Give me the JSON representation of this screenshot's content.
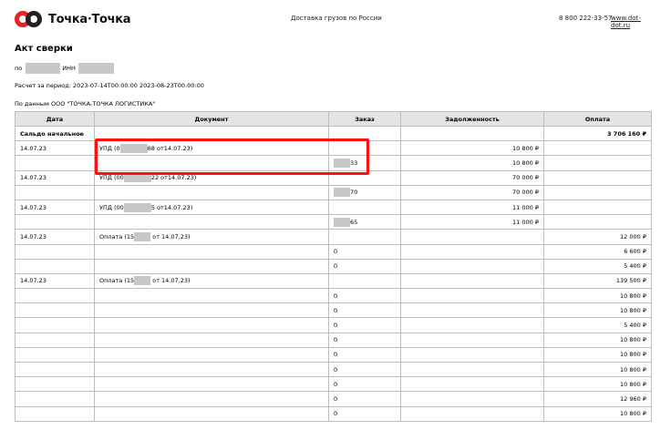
{
  "header": {
    "logo_text": "Точка·Точка",
    "tagline": "Доставка грузов по России",
    "phone": "8 800 222-33-57",
    "site": "www.dot-dot.ru"
  },
  "doc": {
    "title": "Акт сверки",
    "party_prefix": "по",
    "inn_label": "ИНН",
    "period": "Расчет за период: 2023-07-14T00:00:00 2023-08-23T00:00:00",
    "source": "По данным ООО \"ТОЧКА-ТОЧКА ЛОГИСТИКА\""
  },
  "table": {
    "columns": [
      "Дата",
      "Документ",
      "Заказ",
      "Задолженность",
      "Оплата"
    ],
    "rows": [
      [
        "Сальдо начальное",
        "",
        "",
        "",
        "3 706 160 ₽"
      ],
      [
        "14.07.23",
        "УПД (0█████68 от14.07.23)",
        "",
        "10 800 ₽",
        ""
      ],
      [
        "",
        "",
        "███33",
        "10 800 ₽",
        ""
      ],
      [
        "14.07.23",
        "УПД (00█████22 от14.07.23)",
        "",
        "70 000 ₽",
        ""
      ],
      [
        "",
        "",
        "███70",
        "70 000 ₽",
        ""
      ],
      [
        "14.07.23",
        "УПД (00█████5 от14.07.23)",
        "",
        "11 000 ₽",
        ""
      ],
      [
        "",
        "",
        "███65",
        "11 000 ₽",
        ""
      ],
      [
        "14.07.23",
        "Оплата (15███ от 14.07.23)",
        "",
        "",
        "12 000 ₽"
      ],
      [
        "",
        "",
        "0",
        "",
        "6 600 ₽"
      ],
      [
        "",
        "",
        "0",
        "",
        "5 400 ₽"
      ],
      [
        "14.07.23",
        "Оплата (15███ от 14.07.23)",
        "",
        "",
        "139 500 ₽"
      ],
      [
        "",
        "",
        "0",
        "",
        "10 800 ₽"
      ],
      [
        "",
        "",
        "0",
        "",
        "10 800 ₽"
      ],
      [
        "",
        "",
        "0",
        "",
        "5 400 ₽"
      ],
      [
        "",
        "",
        "0",
        "",
        "10 800 ₽"
      ],
      [
        "",
        "",
        "0",
        "",
        "10 800 ₽"
      ],
      [
        "",
        "",
        "0",
        "",
        "10 800 ₽"
      ],
      [
        "",
        "",
        "0",
        "",
        "10 800 ₽"
      ],
      [
        "",
        "",
        "0",
        "",
        "12 960 ₽"
      ],
      [
        "",
        "",
        "0",
        "",
        "10 800 ₽"
      ]
    ]
  }
}
